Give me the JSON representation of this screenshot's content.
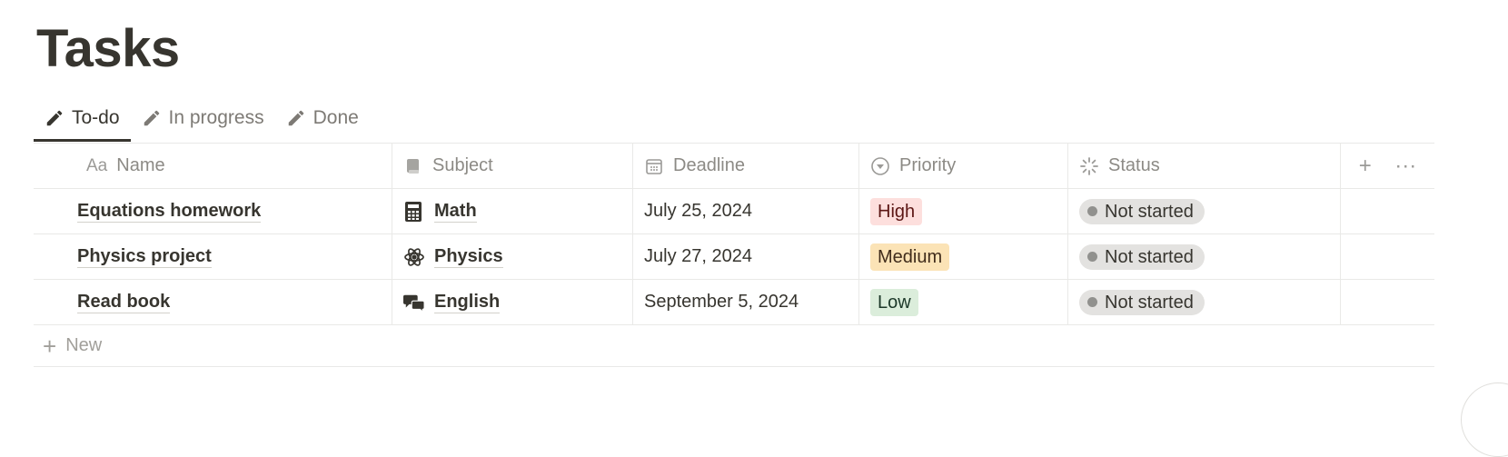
{
  "page": {
    "title": "Tasks"
  },
  "tabs": [
    {
      "label": "To-do",
      "icon": "pencil-icon",
      "active": true
    },
    {
      "label": "In progress",
      "icon": "pencil-icon",
      "active": false
    },
    {
      "label": "Done",
      "icon": "pencil-icon",
      "active": false
    }
  ],
  "table": {
    "headers": {
      "name": {
        "label": "Name",
        "icon": "Aa"
      },
      "subject": {
        "label": "Subject",
        "icon": "book-icon"
      },
      "deadline": {
        "label": "Deadline",
        "icon": "calendar-icon"
      },
      "priority": {
        "label": "Priority",
        "icon": "select-icon"
      },
      "status": {
        "label": "Status",
        "icon": "status-spinner-icon"
      }
    },
    "rows": [
      {
        "name": "Equations homework",
        "subject": "Math",
        "subject_icon": "calculator-icon",
        "deadline": "July 25, 2024",
        "priority": "High",
        "status": "Not started"
      },
      {
        "name": "Physics project",
        "subject": "Physics",
        "subject_icon": "atom-icon",
        "deadline": "July 27, 2024",
        "priority": "Medium",
        "status": "Not started"
      },
      {
        "name": "Read book",
        "subject": "English",
        "subject_icon": "chat-bubbles-icon",
        "deadline": "September 5, 2024",
        "priority": "Low",
        "status": "Not started"
      }
    ],
    "new_row_label": "New"
  },
  "colors": {
    "priority_high_bg": "#fddfdd",
    "priority_high_fg": "#5d1715",
    "priority_medium_bg": "#fbe3b6",
    "priority_medium_fg": "#402c1b",
    "priority_low_bg": "#dbeddb",
    "priority_low_fg": "#1c3829",
    "status_bg": "#e3e2e0"
  }
}
